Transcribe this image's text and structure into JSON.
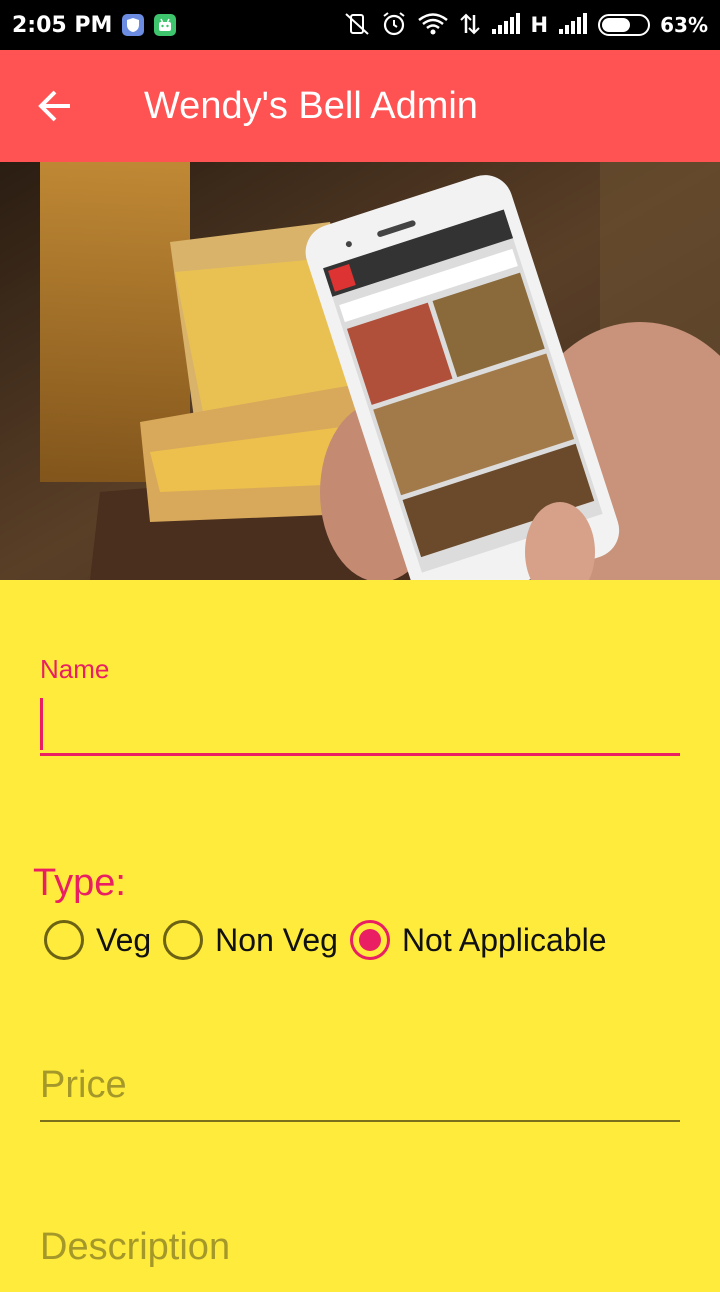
{
  "status_bar": {
    "time": "2:05 PM",
    "network": "H",
    "battery": "63%",
    "battery_level": 0.63,
    "icons": [
      "shield-icon",
      "android-icon",
      "mute-icon",
      "alarm-icon",
      "wifi-icon",
      "data-arrows-icon",
      "signal-icon",
      "signal-icon-2",
      "battery-icon"
    ]
  },
  "app_bar": {
    "title": "Wendy's Bell Admin",
    "back_icon": "back-arrow-icon",
    "background": "#ff5252"
  },
  "form": {
    "name": {
      "label": "Name",
      "value": ""
    },
    "type": {
      "label": "Type:",
      "options": [
        "Veg",
        "Non Veg",
        "Not Applicable"
      ],
      "selected": "Not Applicable"
    },
    "price": {
      "placeholder": "Price"
    },
    "description": {
      "placeholder": "Description"
    }
  },
  "colors": {
    "accent": "#e91e63",
    "background": "#ffeb3b",
    "app_bar": "#ff5252"
  }
}
